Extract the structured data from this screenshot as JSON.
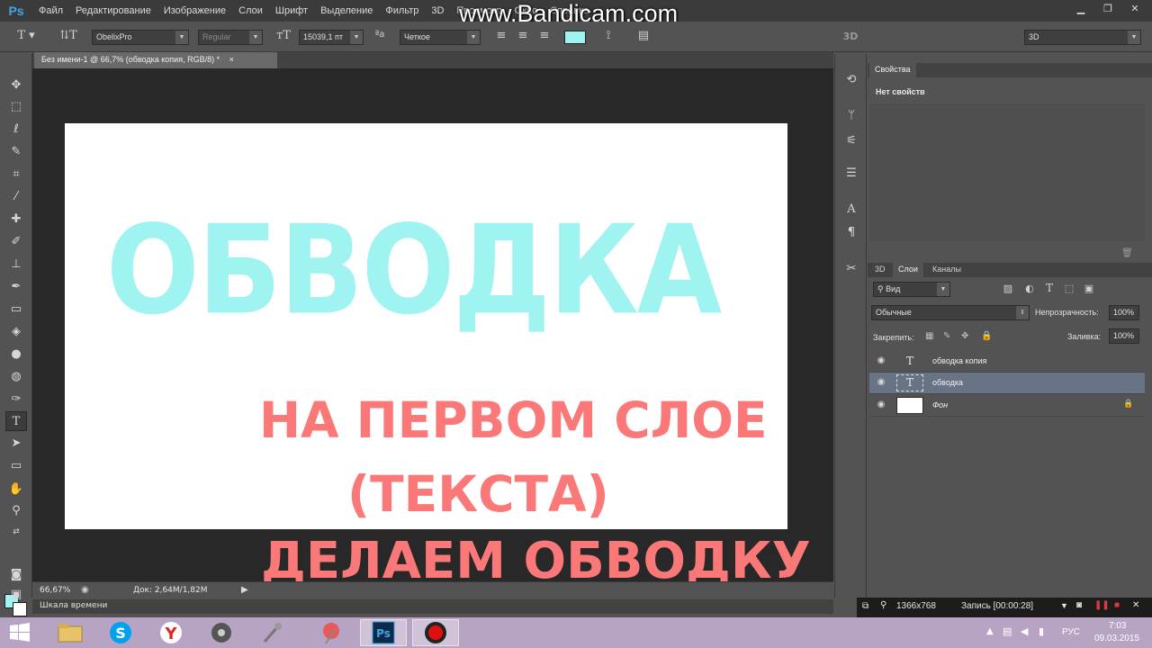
{
  "watermark": "www.Bandicam.com",
  "app_logo": "Ps",
  "menu": [
    "Файл",
    "Редактирование",
    "Изображение",
    "Слои",
    "Шрифт",
    "Выделение",
    "Фильтр",
    "3D",
    "Просмотр",
    "Окно",
    "Справка"
  ],
  "options": {
    "font_family": "ObelixPro",
    "font_style": "Regular",
    "font_size": "15039,1 пт",
    "aa_mode": "Четкое",
    "text_color": "#9ff3f0",
    "workspace_label": "3D",
    "workspace_select": "3D"
  },
  "document_tab": {
    "title": "Без имени-1 @ 66,7% (обводка копия, RGB/8) *",
    "close": "×"
  },
  "canvas": {
    "headline": "ОБВОДКА",
    "line1": "НА ПЕРВОМ СЛОЕ",
    "line2": "(ТЕКСТА)",
    "line3": "ДЕЛАЕМ ОБВОДКУ",
    "headline_color": "#9ff3f0",
    "caption_color": "#fb7878"
  },
  "status": {
    "zoom": "66,67%",
    "doc": "Док: 2,64M/1,82M"
  },
  "timeline_label": "Шкала времени",
  "properties": {
    "tab": "Свойства",
    "empty": "Нет свойств"
  },
  "layers_panel": {
    "tabs": [
      "3D",
      "Слои",
      "Каналы"
    ],
    "filter": "Вид",
    "blend_mode": "Обычные",
    "opacity_label": "Непрозрачность:",
    "opacity": "100%",
    "lock_label": "Закрепить:",
    "fill_label": "Заливка:",
    "fill": "100%",
    "layers": [
      {
        "name": "обводка копия",
        "type": "text",
        "selected": false
      },
      {
        "name": "обводка",
        "type": "text",
        "selected": true
      },
      {
        "name": "Фон",
        "type": "background",
        "selected": false,
        "locked": true
      }
    ]
  },
  "bandicam": {
    "resolution": "1366x768",
    "record": "Запись [00:00:28]"
  },
  "taskbar": {
    "lang": "РУС",
    "time": "7:03",
    "date": "09.03.2015"
  }
}
